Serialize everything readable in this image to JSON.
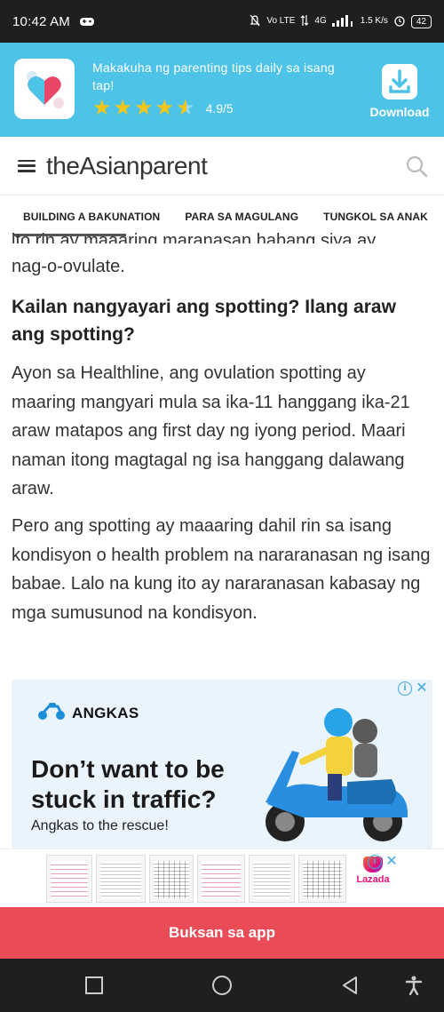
{
  "status_bar": {
    "time": "10:42 AM",
    "network_label": "Vo LTE",
    "network_type": "4G",
    "speed": "1.5 K/s",
    "battery": "42"
  },
  "app_banner": {
    "promo_text": "Makakuha ng parenting tips daily sa isang tap!",
    "stars": 4.5,
    "rating": "4.9/5",
    "download_label": "Download",
    "accent_color": "#4ec3e8"
  },
  "site_header": {
    "logo": "theAsianparent"
  },
  "nav": {
    "tabs": [
      "BUILDING A BAKUNATION",
      "PARA SA MAGULANG",
      "TUNGKOL SA ANAK"
    ]
  },
  "article": {
    "cut_line": "ito rin ay maaaring maranasan habang siya ay",
    "lead_end": "nag-o-ovulate.",
    "heading": "Kailan nangyayari ang spotting? Ilang araw ang spotting?",
    "paragraph_1": "Ayon sa Healthline, ang ovulation spotting ay maaring mangyari mula sa ika-11 hanggang ika-21 araw matapos ang first day ng iyong period. Maari naman itong magtagal ng isa hanggang dalawang araw.",
    "paragraph_2": "Pero ang spotting ay maaaring dahil rin sa isang kondisyon o health problem na nararanasan ng isang babae. Lalo na kung ito ay nararanasan kabasay ng mga sumusunod na kondisyon."
  },
  "ad": {
    "brand": "ANGKAS",
    "headline": "Don’t want to be stuck in traffic?",
    "subline": "Angkas to the rescue!"
  },
  "bottom_ad": {
    "brand": "Lazada"
  },
  "open_app": {
    "label": "Buksan sa app",
    "color": "#e94b57"
  }
}
